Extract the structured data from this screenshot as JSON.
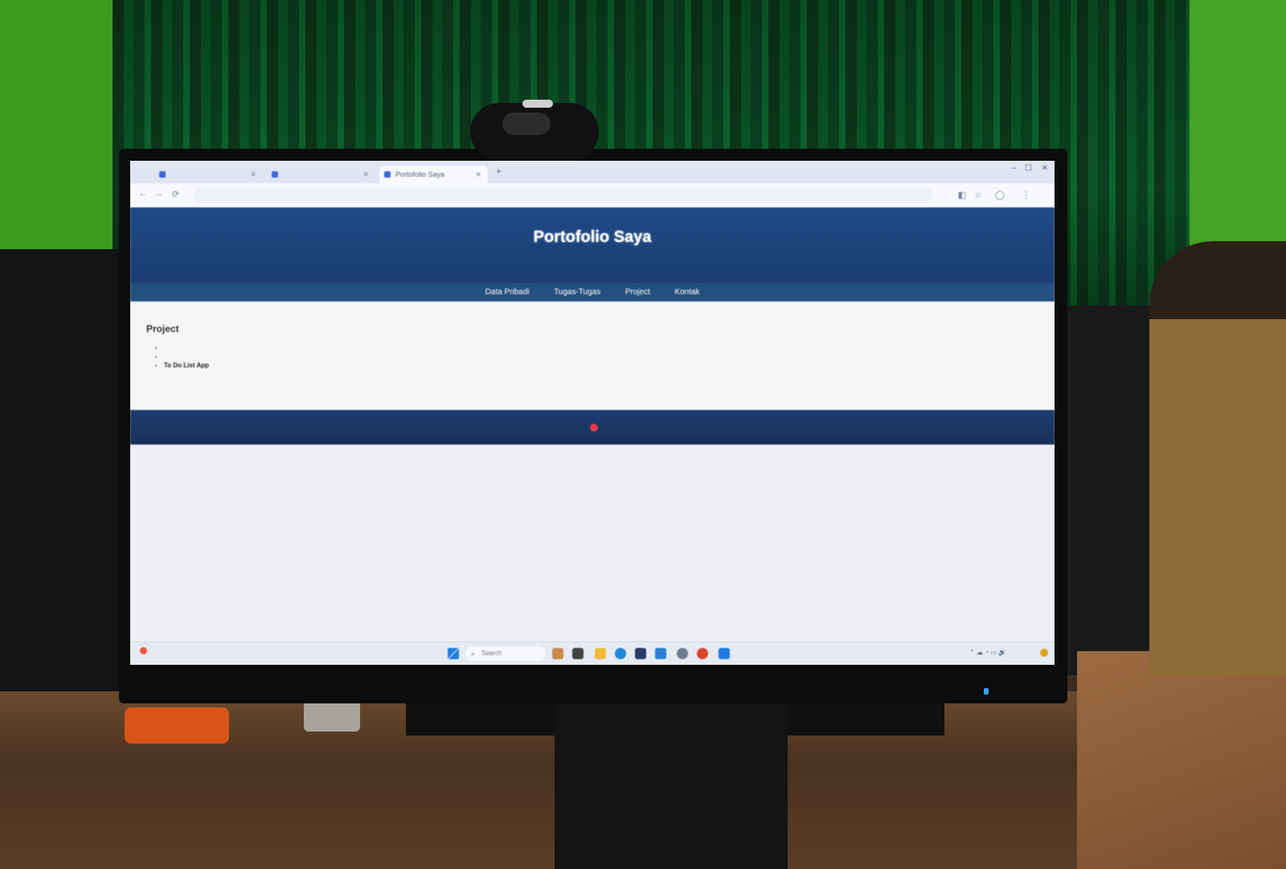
{
  "browser": {
    "tabs": [
      {
        "label": "",
        "active": false
      },
      {
        "label": "",
        "active": false
      },
      {
        "label": "Portofolio Saya",
        "active": true
      }
    ],
    "address": "",
    "new_tab_label": "+"
  },
  "site": {
    "title": "Portofolio Saya",
    "subtitle": "",
    "nav": [
      "Data Pribadi",
      "Tugas-Tugas",
      "Project",
      "Kontak"
    ],
    "section_title": "Project",
    "projects": [
      {
        "name": "",
        "desc": ""
      },
      {
        "name": "",
        "desc": ""
      },
      {
        "name": "To Do List App",
        "desc": ""
      }
    ],
    "footer": ""
  },
  "taskbar": {
    "search_placeholder": "Search",
    "weather": "",
    "time": "",
    "date": ""
  },
  "colors": {
    "header": "#204a86",
    "nav": "#24507f",
    "footer": "#1e3f70",
    "accent": "#e23a4f"
  }
}
